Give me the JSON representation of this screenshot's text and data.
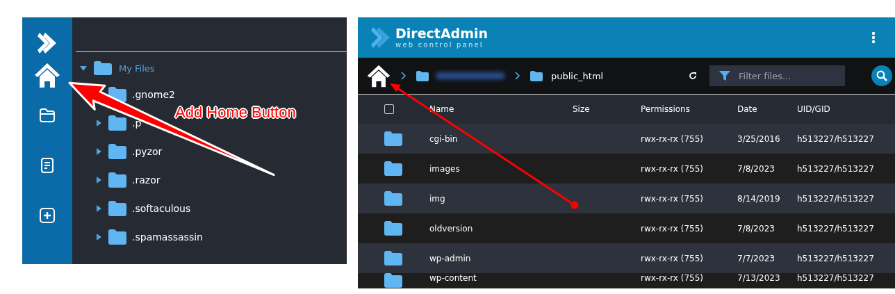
{
  "left_panel": {
    "sidebar": {
      "items": [
        {
          "kind": "home"
        },
        {
          "kind": "folder"
        },
        {
          "kind": "document"
        },
        {
          "kind": "add"
        }
      ]
    },
    "tree": [
      {
        "label": "My Files",
        "expanded": true,
        "children": [
          {
            "label": ".gnome2"
          },
          {
            "label": ".p",
            "expanded": false
          },
          {
            "label": ".pyzor",
            "expanded": false
          },
          {
            "label": ".razor",
            "expanded": false
          },
          {
            "label": ".softaculous",
            "expanded": false
          },
          {
            "label": ".spamassassin",
            "expanded": false
          }
        ]
      }
    ],
    "annotation": {
      "label": "Add Home Button"
    }
  },
  "right_panel": {
    "header": {
      "brand": "DirectAdmin",
      "tagline": "web control panel"
    },
    "breadcrumb": {
      "items": [
        {
          "kind": "redacted"
        },
        {
          "kind": "folder",
          "label": "public_html"
        }
      ]
    },
    "filter": {
      "placeholder": "Filter files..."
    },
    "table": {
      "select_all": {
        "checked": false
      },
      "columns": [
        "Name",
        "Size",
        "Permissions",
        "Date",
        "UID/GID"
      ],
      "rows": [
        {
          "name": "cgi-bin",
          "size": "",
          "permissions": "rwx-rx-rx (755)",
          "date": "3/25/2016",
          "owner": "h513227/h513227"
        },
        {
          "name": "images",
          "size": "",
          "permissions": "rwx-rx-rx (755)",
          "date": "7/8/2023",
          "owner": "h513227/h513227"
        },
        {
          "name": "img",
          "size": "",
          "permissions": "rwx-rx-rx (755)",
          "date": "8/14/2019",
          "owner": "h513227/h513227"
        },
        {
          "name": "oldversion",
          "size": "",
          "permissions": "rwx-rx-rx (755)",
          "date": "7/8/2023",
          "owner": "h513227/h513227"
        },
        {
          "name": "wp-admin",
          "size": "",
          "permissions": "rwx-rx-rx (755)",
          "date": "7/7/2023",
          "owner": "h513227/h513227"
        },
        {
          "name": "wp-content",
          "size": "",
          "permissions": "rwx-rx-rx (755)",
          "date": "7/13/2023",
          "owner": "h513227/h513227"
        }
      ]
    }
  }
}
